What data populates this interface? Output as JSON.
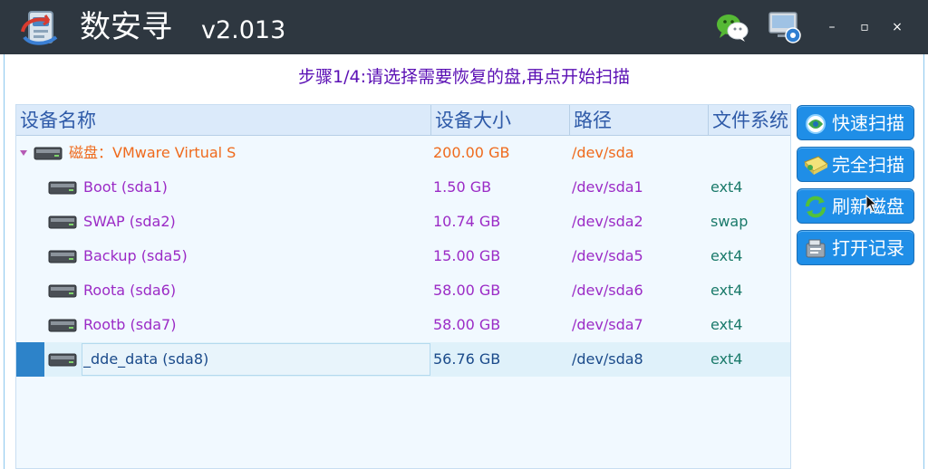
{
  "titlebar": {
    "app_name": "数安寻",
    "version": "v2.013",
    "wechat_icon": "wechat-icon",
    "settings_icon": "settings-icon",
    "minimize_label": "–",
    "maximize_label": "▫",
    "close_label": "×"
  },
  "step_text": "步骤1/4:请选择需要恢复的盘,再点开始扫描",
  "table": {
    "columns": [
      "设备名称",
      "设备大小",
      "路径",
      "文件系统"
    ],
    "disk": {
      "name": "磁盘：VMware Virtual S",
      "size": "200.00 GB",
      "path": "/dev/sda",
      "fs": ""
    },
    "partitions": [
      {
        "name": "Boot (sda1)",
        "size": "1.50 GB",
        "path": "/dev/sda1",
        "fs": "ext4"
      },
      {
        "name": "SWAP (sda2)",
        "size": "10.74 GB",
        "path": "/dev/sda2",
        "fs": "swap"
      },
      {
        "name": "Backup (sda5)",
        "size": "15.00 GB",
        "path": "/dev/sda5",
        "fs": "ext4"
      },
      {
        "name": "Roota (sda6)",
        "size": "58.00 GB",
        "path": "/dev/sda6",
        "fs": "ext4"
      },
      {
        "name": "Rootb (sda7)",
        "size": "58.00 GB",
        "path": "/dev/sda7",
        "fs": "ext4"
      },
      {
        "name": "_dde_data (sda8)",
        "size": "56.76 GB",
        "path": "/dev/sda8",
        "fs": "ext4"
      }
    ],
    "selected_partition": "_dde_data (sda8)"
  },
  "buttons": [
    {
      "label": "快速扫描",
      "icon": "quick-scan-icon"
    },
    {
      "label": "完全扫描",
      "icon": "full-scan-icon"
    },
    {
      "label": "刷新磁盘",
      "icon": "refresh-icon"
    },
    {
      "label": "打开记录",
      "icon": "open-record-icon"
    }
  ],
  "colors": {
    "titlebar": "#2e3740",
    "step_text": "#5a0fb4",
    "disk_text": "#ef6a1c",
    "partition_text": "#9b2bc6",
    "fs_text": "#1a7a6a",
    "button": "#1f8ee7"
  }
}
